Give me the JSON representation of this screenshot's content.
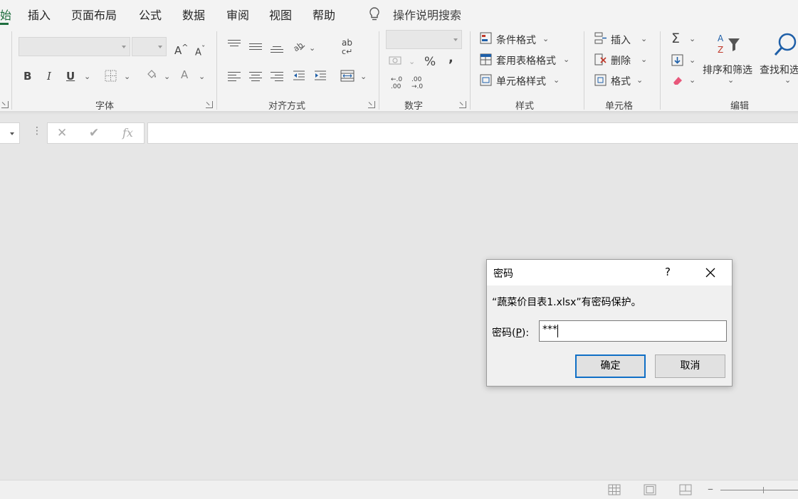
{
  "menu": {
    "tabs": [
      {
        "label": "始",
        "active": true
      },
      {
        "label": "插入"
      },
      {
        "label": "页面布局"
      },
      {
        "label": "公式"
      },
      {
        "label": "数据"
      },
      {
        "label": "审阅"
      },
      {
        "label": "视图"
      },
      {
        "label": "帮助"
      }
    ],
    "search_label": "操作说明搜索"
  },
  "ribbon": {
    "font_group": {
      "label": "字体",
      "bold": "B",
      "italic": "I",
      "underline": "U",
      "grow": "A",
      "shrink": "A",
      "font_color": "A"
    },
    "align_group": {
      "label": "对齐方式",
      "wrap": "ab"
    },
    "number_group": {
      "label": "数字",
      "percent": "%",
      "comma": ",",
      "inc_decimal": ".00",
      "dec_decimal": ".0"
    },
    "styles_group": {
      "label": "样式",
      "conditional": "条件格式",
      "table_format": "套用表格格式",
      "cell_styles": "单元格样式"
    },
    "cells_group": {
      "label": "单元格",
      "insert": "插入",
      "delete": "删除",
      "format": "格式"
    },
    "edit_group": {
      "label": "编辑",
      "sum": "Σ",
      "sort_filter": "排序和筛选",
      "find_select": "查找和选"
    }
  },
  "formula_bar": {
    "fx": "fx",
    "value": ""
  },
  "dialog": {
    "title": "密码",
    "help": "?",
    "message": "“蔬菜价目表1.xlsx”有密码保护。",
    "label_prefix": "密码(",
    "label_key": "P",
    "label_suffix": "):",
    "password_value": "***",
    "ok_label": "确定",
    "cancel_label": "取消"
  },
  "colors": {
    "accent": "#1e6e3e",
    "dialog_focus": "#0f6fc6",
    "background": "#e6e6e6"
  }
}
